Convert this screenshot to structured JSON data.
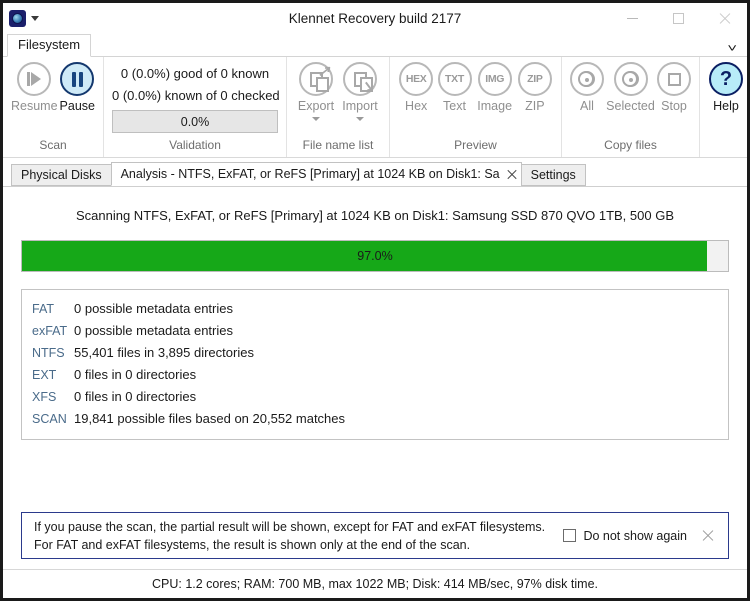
{
  "window": {
    "title": "Klennet Recovery build 2177",
    "app_icon": "disk-drive-icon",
    "quick_access_caret": "chevron-down-icon",
    "controls": {
      "minimize": "minimize-icon",
      "maximize": "maximize-icon",
      "close": "close-icon"
    }
  },
  "ribbon": {
    "tabs": [
      {
        "label": "Filesystem",
        "active": true
      }
    ],
    "expand_caret": "chevron-down-icon",
    "groups": [
      {
        "label": "Scan",
        "buttons": [
          {
            "label": "Resume",
            "icon": "play-icon",
            "enabled": false
          },
          {
            "label": "Pause",
            "icon": "pause-icon",
            "enabled": true
          }
        ]
      },
      {
        "label": "Validation",
        "line1": "0 (0.0%) good of 0 known",
        "line2": "0 (0.0%) known of 0 checked",
        "progress_label": "0.0%",
        "progress_percent": 0
      },
      {
        "label": "File name list",
        "buttons": [
          {
            "label": "Export",
            "icon": "export-icon",
            "enabled": false,
            "has_menu": true
          },
          {
            "label": "Import",
            "icon": "import-icon",
            "enabled": false,
            "has_menu": true
          }
        ]
      },
      {
        "label": "Preview",
        "buttons": [
          {
            "label": "Hex",
            "icon": "hex-icon",
            "tag": "HEX",
            "enabled": false
          },
          {
            "label": "Text",
            "icon": "text-icon",
            "tag": "TXT",
            "enabled": false
          },
          {
            "label": "Image",
            "icon": "image-icon",
            "tag": "IMG",
            "enabled": false
          },
          {
            "label": "ZIP",
            "icon": "zip-icon",
            "tag": "ZIP",
            "enabled": false
          }
        ]
      },
      {
        "label": "Copy files",
        "buttons": [
          {
            "label": "All",
            "icon": "copy-all-icon",
            "enabled": false
          },
          {
            "label": "Selected",
            "icon": "copy-selected-icon",
            "enabled": false
          },
          {
            "label": "Stop",
            "icon": "stop-icon",
            "enabled": false
          }
        ]
      },
      {
        "label": "",
        "buttons": [
          {
            "label": "Help",
            "icon": "help-icon",
            "enabled": true
          }
        ]
      }
    ]
  },
  "doc_tabs": [
    {
      "label": "Physical Disks",
      "active": false,
      "closable": false
    },
    {
      "label": "Analysis - NTFS, ExFAT, or ReFS [Primary] at 1024 KB on Disk1: Sa",
      "active": true,
      "closable": true,
      "close_icon": "close-icon"
    },
    {
      "label": "Settings",
      "active": false,
      "closable": false
    }
  ],
  "main": {
    "scan_status": "Scanning NTFS, ExFAT, or ReFS [Primary] at 1024 KB on Disk1: Samsung SSD 870 QVO 1TB, 500 GB",
    "progress": {
      "percent": 97.0,
      "label": "97.0%",
      "fill_color": "#16a818"
    },
    "results": [
      {
        "fs": "FAT",
        "detail": "0 possible metadata entries"
      },
      {
        "fs": "exFAT",
        "detail": "0 possible metadata entries"
      },
      {
        "fs": "NTFS",
        "detail": "55,401 files in 3,895 directories"
      },
      {
        "fs": "EXT",
        "detail": "0 files in 0 directories"
      },
      {
        "fs": "XFS",
        "detail": "0 files in 0 directories"
      },
      {
        "fs": "SCAN",
        "detail": "19,841 possible files based on 20,552 matches"
      }
    ]
  },
  "notification": {
    "line1": "If you pause the scan, the partial result will be shown, except for FAT and exFAT filesystems.",
    "line2": "For FAT and exFAT filesystems, the result is shown only at the end of the scan.",
    "checkbox_label": "Do not show again",
    "checkbox_checked": false,
    "close_icon": "close-icon",
    "border_color": "#2b3a8c"
  },
  "statusbar": {
    "text": "CPU: 1.2 cores; RAM: 700 MB, max 1022 MB; Disk: 414 MB/sec, 97% disk time."
  }
}
